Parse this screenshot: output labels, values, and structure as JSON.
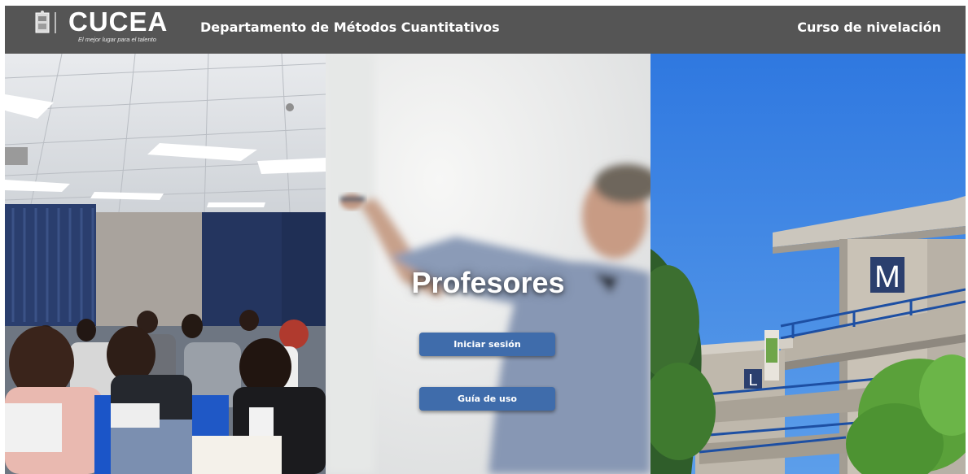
{
  "header": {
    "brand": "CUCEA",
    "slogan": "El mejor lugar para el talento",
    "department": "Departamento de Métodos Cuantitativos",
    "course": "Curso de nivelación"
  },
  "hero": {
    "title": "Profesores",
    "buttons": {
      "login": "Iniciar sesión",
      "guide": "Guía de uso"
    }
  },
  "signs": {
    "building_m": "M",
    "building_l": "L"
  },
  "colors": {
    "header_bg": "#555555",
    "button_bg": "#3f6cab",
    "sky": "#2f7ae0"
  }
}
